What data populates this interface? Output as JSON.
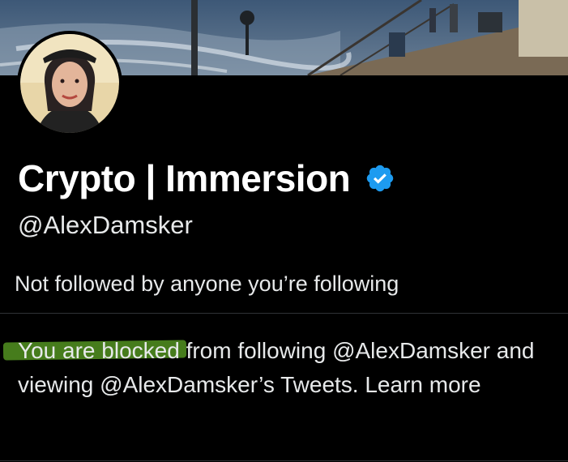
{
  "profile": {
    "display_name": "Crypto | Immersion",
    "handle": "@AlexDamsker",
    "verified": true,
    "followed_by_text": "Not followed by anyone you’re following",
    "blocked_notice": "You are blocked from following @AlexDamsker and viewing @AlexDamsker’s Tweets. Learn more"
  },
  "colors": {
    "background": "#000000",
    "text": "#e7e9ea",
    "verified_badge": "#1d9bf0",
    "highlight": "#4e8a1f"
  },
  "icons": {
    "verified": "verified-badge-icon"
  }
}
